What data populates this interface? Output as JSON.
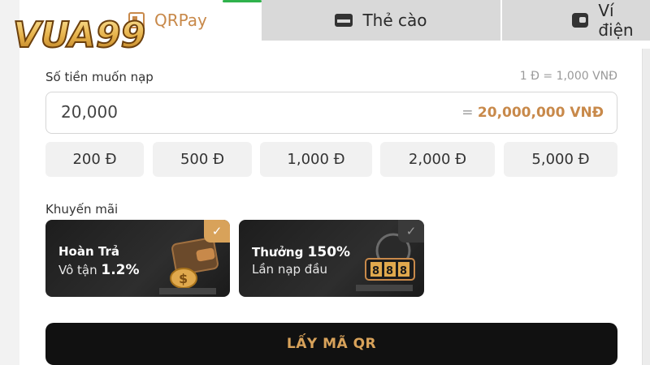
{
  "brand": {
    "logo_text": "VUA99",
    "accent": "#c8894a",
    "gold": "#d8a25a"
  },
  "tabs": [
    {
      "label": "QRPay",
      "icon": "qr-icon",
      "active": true
    },
    {
      "label": "Thẻ cào",
      "icon": "card-icon",
      "active": false
    },
    {
      "label": "Ví điện",
      "icon": "wallet-icon",
      "active": false
    }
  ],
  "amount": {
    "label": "Số tiền muốn nạp",
    "rate": "1 Đ = 1,000 VNĐ",
    "value": "20,000",
    "equals": "=",
    "converted": "20,000,000 VNĐ"
  },
  "quick_amounts": [
    "200 Đ",
    "500 Đ",
    "1,000 Đ",
    "2,000 Đ",
    "5,000 Đ"
  ],
  "promotions": {
    "label": "Khuyến mãi",
    "items": [
      {
        "title_a": "Hoàn Trả",
        "title_b": "",
        "sub_a": "Vô tận ",
        "sub_b": "1.2%",
        "selected": true
      },
      {
        "title_a": "Thưởng ",
        "title_b": "150%",
        "sub_a": "Lần nạp đầu",
        "sub_b": "",
        "selected": false
      }
    ]
  },
  "submit_label": "LẤY MÃ QR"
}
